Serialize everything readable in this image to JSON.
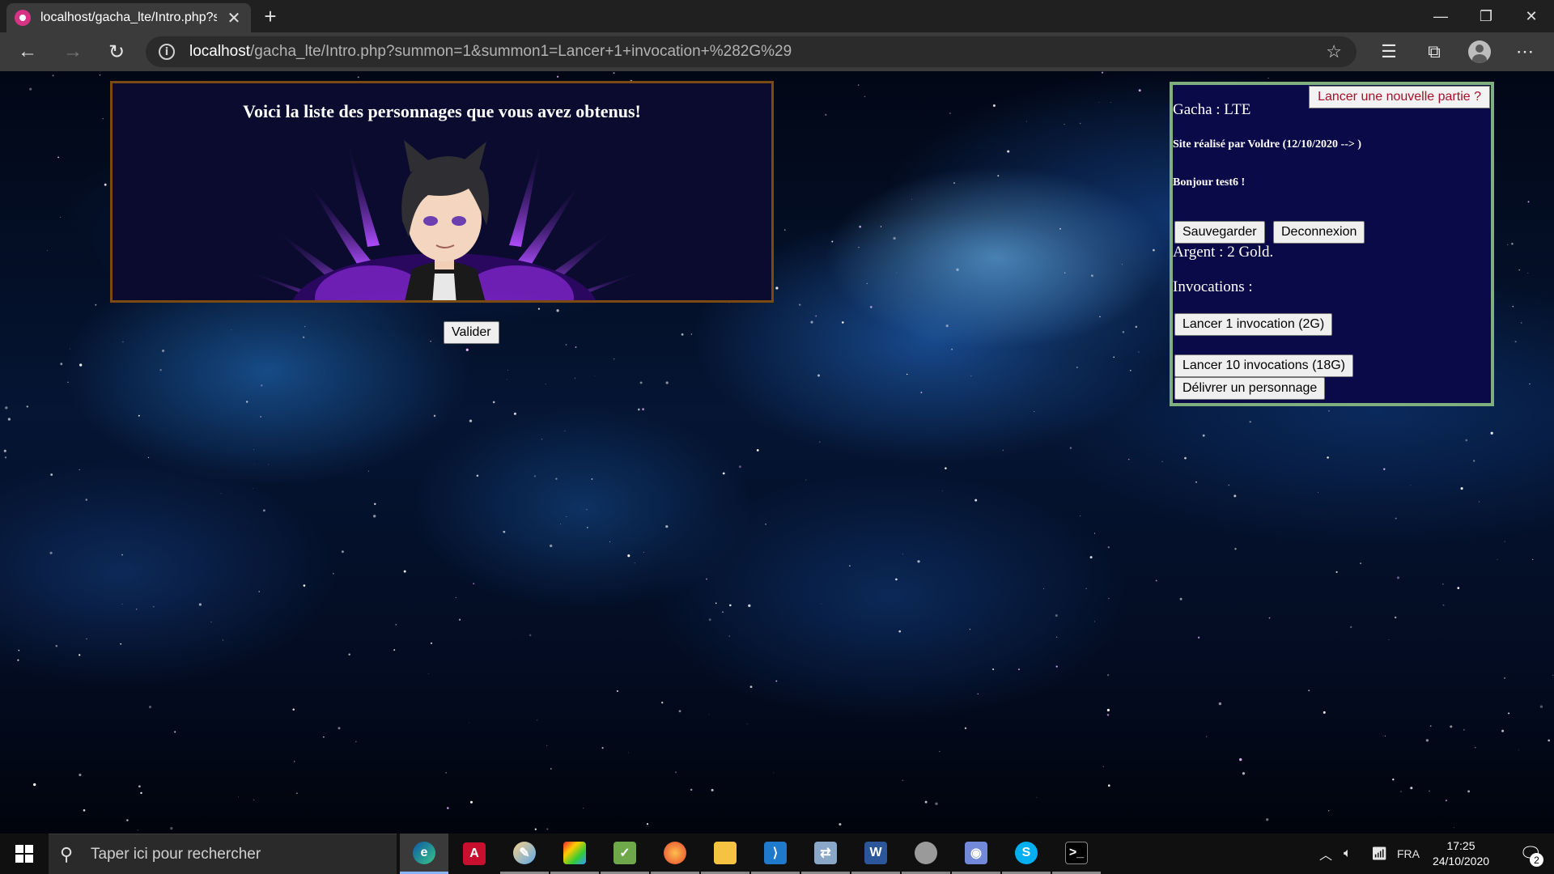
{
  "browser": {
    "tab_title": "localhost/gacha_lte/Intro.php?su",
    "url_host": "localhost",
    "url_path": "/gacha_lte/Intro.php?summon=1&summon1=Lancer+1+invocation+%282G%29"
  },
  "intro": {
    "title": "Voici la liste des personnages que vous avez obtenus!",
    "validate_label": "Valider"
  },
  "side_panel": {
    "new_game_label": "Lancer une nouvelle partie ?",
    "game_name": "Gacha : LTE",
    "credit": "Site réalisé par Voldre (12/10/2020 --> )",
    "greeting": "Bonjour test6 !",
    "save_label": "Sauvegarder",
    "logout_label": "Deconnexion",
    "money": "Argent : 2 Gold.",
    "invocations_heading": "Invocations :",
    "summon1_label": "Lancer 1 invocation (2G)",
    "summon10_label": "Lancer 10 invocations (18G)",
    "release_label": "Délivrer un personnage"
  },
  "taskbar": {
    "search_placeholder": "Taper ici pour rechercher",
    "language": "FRA",
    "time": "17:25",
    "date": "24/10/2020",
    "notification_count": "2",
    "apps": [
      "edge-icon",
      "acrobat-icon",
      "paint-icon",
      "colors-icon",
      "notepad-icon",
      "firefox-icon",
      "explorer-icon",
      "vscode-icon",
      "network-icon",
      "word-icon",
      "disc-icon",
      "discord-icon",
      "skype-icon",
      "terminal-icon"
    ]
  },
  "colors": {
    "panel_border_left": "#7a4a12",
    "panel_border_right": "#7fae7f",
    "panel_bg_right": "#0a0a48",
    "new_game_text": "#a8102a"
  }
}
